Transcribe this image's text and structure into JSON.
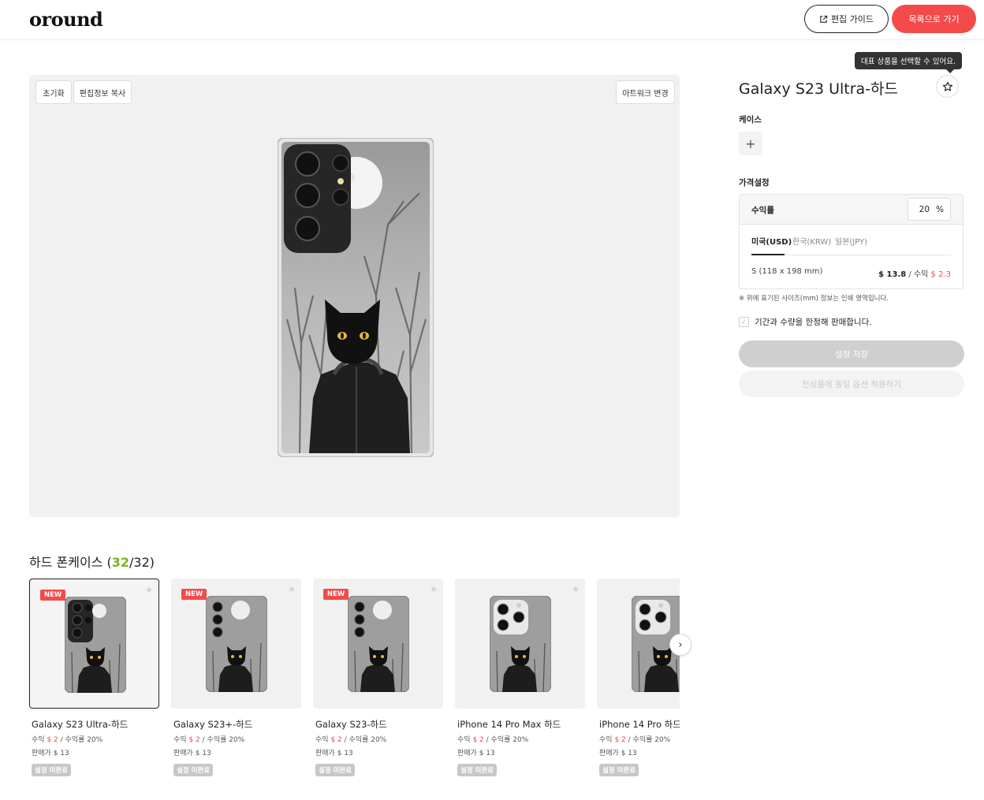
{
  "header": {
    "logo": "oround",
    "guide_label": "편집 가이드",
    "back_label": "목록으로 가기"
  },
  "editor": {
    "reset_label": "초기화",
    "copy_label": "편집정보 복사",
    "change_art_label": "아트워크 변경"
  },
  "product": {
    "tooltip": "대표 상품을 선택할 수 있어요.",
    "title": "Galaxy S23 Ultra-하드",
    "case_label": "케이스",
    "plus": "+",
    "price_setting_label": "가격설정",
    "rate_label": "수익률",
    "rate_value": "20",
    "rate_unit": "%",
    "currency_tabs": [
      "미국(USD)",
      "한국(KRW)",
      "일본(JPY)"
    ],
    "size_label": "S (118 x 198 mm)",
    "size_price": "$ 13.8",
    "size_profit_label": "/ 수익",
    "size_profit": "$ 2.3",
    "notice": "※ 위에 표기된 사이즈(mm) 정보는 인쇄 영역입니다.",
    "limited_label": "기간과 수량을 한정해 판매합니다.",
    "save_label": "설정 저장",
    "apply_all_label": "전상품에 동일 옵션 적용하기"
  },
  "list": {
    "title_prefix": "하드 폰케이스 (",
    "count_done": "32",
    "count_sep": "/32)",
    "cards": [
      {
        "name": "Galaxy S23 Ultra-하드",
        "is_new": true,
        "camera": "ultra"
      },
      {
        "name": "Galaxy S23+-하드",
        "is_new": true,
        "camera": "plus"
      },
      {
        "name": "Galaxy S23-하드",
        "is_new": true,
        "camera": "plus"
      },
      {
        "name": "iPhone 14 Pro Max 하드",
        "is_new": false,
        "camera": "iphone"
      },
      {
        "name": "iPhone 14 Pro 하드",
        "is_new": false,
        "camera": "iphone"
      }
    ],
    "card_profit_prefix": "수익",
    "card_profit": "$ 2",
    "card_rate": "/ 수익률 20%",
    "card_sale": "판매가 $ 13",
    "card_badge": "설정 미완료",
    "new_badge": "NEW"
  }
}
